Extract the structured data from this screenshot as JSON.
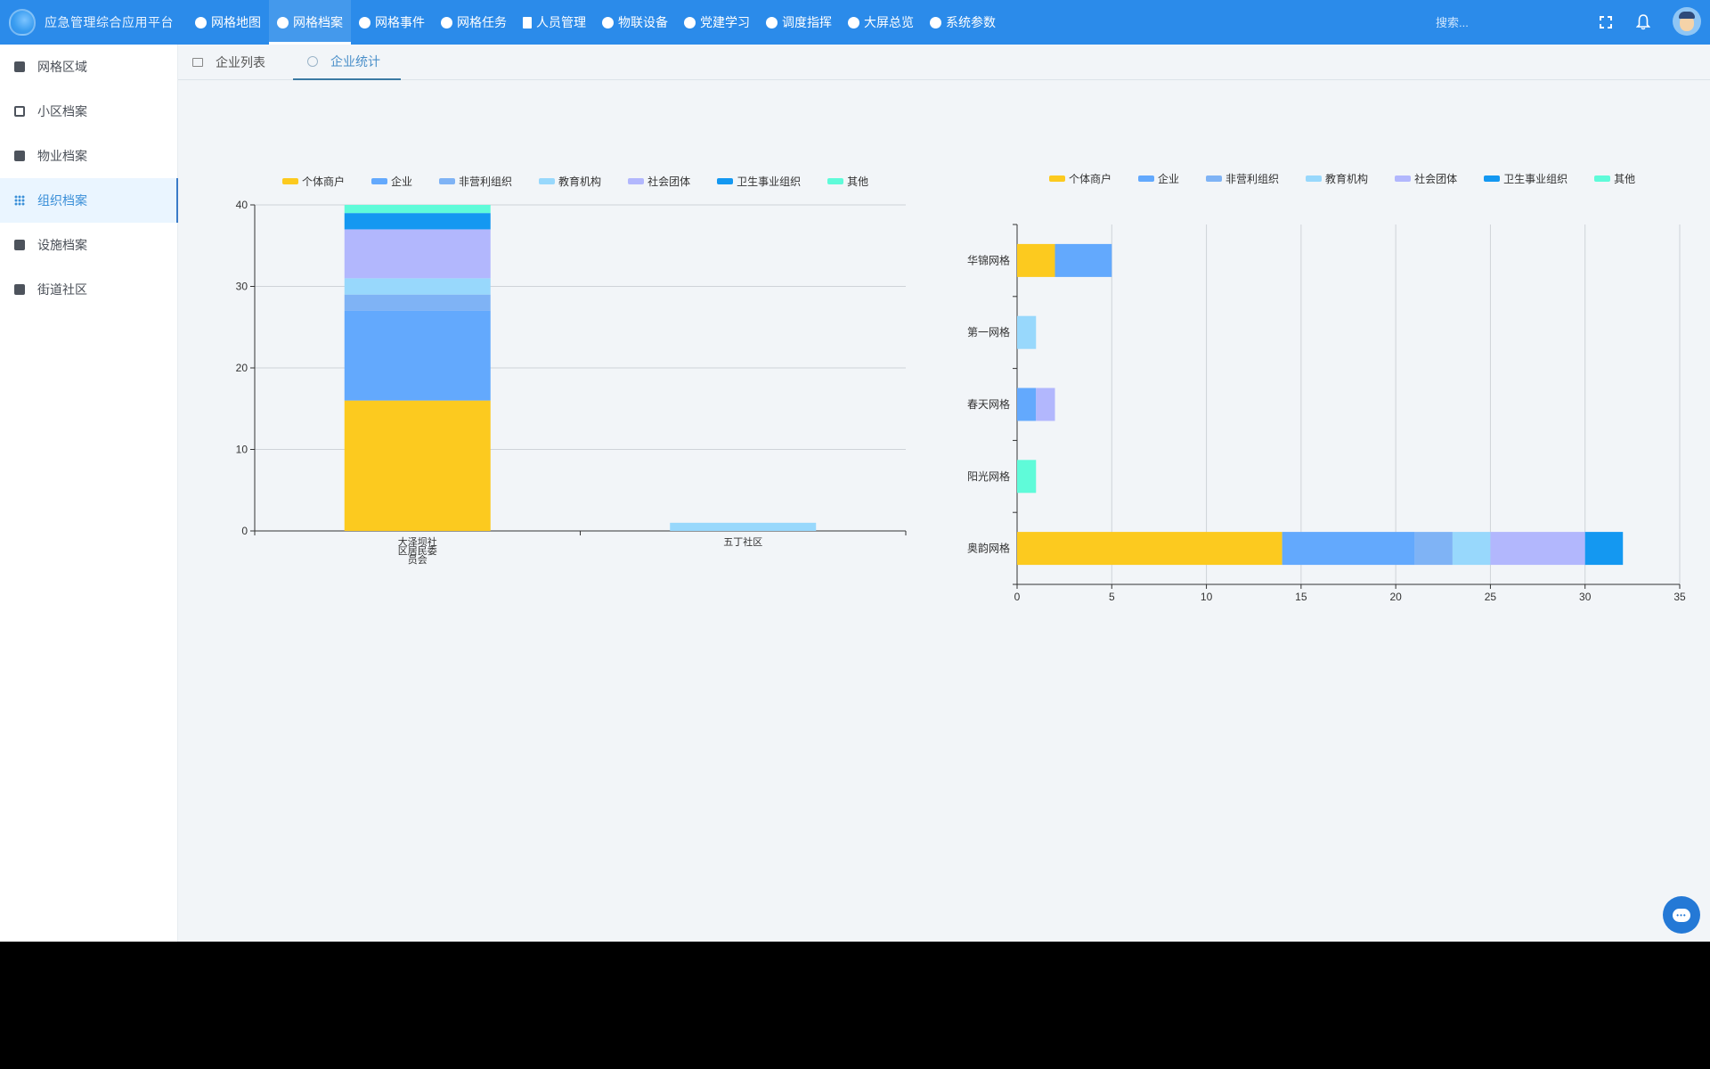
{
  "app": {
    "title": "应急管理综合应用平台"
  },
  "nav": {
    "items": [
      {
        "label": "网格地图",
        "icon": "globe-icon",
        "active": false
      },
      {
        "label": "网格档案",
        "icon": "archive-circle-icon",
        "active": true
      },
      {
        "label": "网格事件",
        "icon": "event-icon",
        "active": false
      },
      {
        "label": "网格任务",
        "icon": "task-cloud-icon",
        "active": false
      },
      {
        "label": "人员管理",
        "icon": "document-icon",
        "active": false
      },
      {
        "label": "物联设备",
        "icon": "device-icon",
        "active": false
      },
      {
        "label": "党建学习",
        "icon": "book-icon",
        "active": false
      },
      {
        "label": "调度指挥",
        "icon": "dispatch-icon",
        "active": false
      },
      {
        "label": "大屏总览",
        "icon": "screen-icon",
        "active": false
      },
      {
        "label": "系统参数",
        "icon": "settings-icon",
        "active": false
      }
    ],
    "search_placeholder": "搜索..."
  },
  "sidebar": {
    "items": [
      {
        "label": "网格区域",
        "icon": "chart-square-icon",
        "active": false
      },
      {
        "label": "小区档案",
        "icon": "window-icon",
        "active": false
      },
      {
        "label": "物业档案",
        "icon": "checkbox-icon",
        "active": false
      },
      {
        "label": "组织档案",
        "icon": "grid-dots-icon",
        "active": true
      },
      {
        "label": "设施档案",
        "icon": "inbox-icon",
        "active": false
      },
      {
        "label": "街道社区",
        "icon": "box-icon",
        "active": false
      }
    ]
  },
  "tabs": [
    {
      "label": "企业列表",
      "active": false
    },
    {
      "label": "企业统计",
      "active": true
    }
  ],
  "chart_data": [
    {
      "type": "bar",
      "orientation": "vertical",
      "stacked": true,
      "categories": [
        "大泽坝社区居民委员会",
        "五丁社区"
      ],
      "series": [
        {
          "name": "个体商户",
          "color": "#fcca1f",
          "values": [
            16,
            0
          ]
        },
        {
          "name": "企业",
          "color": "#63a9fd",
          "values": [
            11,
            0
          ]
        },
        {
          "name": "非营利组织",
          "color": "#7fb3f5",
          "values": [
            2,
            0
          ]
        },
        {
          "name": "教育机构",
          "color": "#98d8fc",
          "values": [
            2,
            1
          ]
        },
        {
          "name": "社会团体",
          "color": "#b2b7fd",
          "values": [
            6,
            0
          ]
        },
        {
          "name": "卫生事业组织",
          "color": "#1498f1",
          "values": [
            2,
            0
          ]
        },
        {
          "name": "其他",
          "color": "#5ffbd9",
          "values": [
            1,
            0
          ]
        }
      ],
      "yticks": [
        0,
        10,
        20,
        30,
        40
      ],
      "ylim": [
        0,
        40
      ],
      "legend": "top",
      "grid": true
    },
    {
      "type": "bar",
      "orientation": "horizontal",
      "stacked": true,
      "categories": [
        "华锦网格",
        "第一网格",
        "春天网格",
        "阳光网格",
        "奥韵网格"
      ],
      "series": [
        {
          "name": "个体商户",
          "color": "#fcca1f",
          "values": [
            2,
            0,
            0,
            0,
            14
          ]
        },
        {
          "name": "企业",
          "color": "#63a9fd",
          "values": [
            3,
            0,
            1,
            0,
            7
          ]
        },
        {
          "name": "非营利组织",
          "color": "#7fb3f5",
          "values": [
            0,
            0,
            0,
            0,
            2
          ]
        },
        {
          "name": "教育机构",
          "color": "#98d8fc",
          "values": [
            0,
            1,
            0,
            0,
            2
          ]
        },
        {
          "name": "社会团体",
          "color": "#b2b7fd",
          "values": [
            0,
            0,
            1,
            0,
            5
          ]
        },
        {
          "name": "卫生事业组织",
          "color": "#1498f1",
          "values": [
            0,
            0,
            0,
            0,
            2
          ]
        },
        {
          "name": "其他",
          "color": "#5ffbd9",
          "values": [
            0,
            0,
            0,
            1,
            0
          ]
        }
      ],
      "xticks": [
        0,
        5,
        10,
        15,
        20,
        25,
        30,
        35
      ],
      "xlim": [
        0,
        35
      ],
      "legend": "top",
      "grid": true
    }
  ]
}
